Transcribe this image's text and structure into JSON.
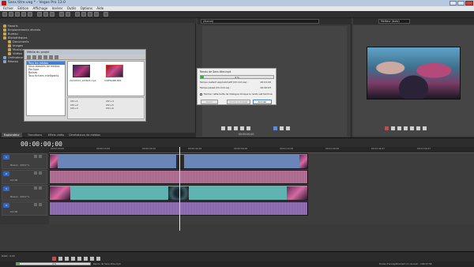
{
  "window": {
    "title": "Sans titre.veg * - Vegas Pro 13.0"
  },
  "menu": [
    "Fichier",
    "Edition",
    "Affichage",
    "Insérer",
    "Outils",
    "Options",
    "Aide"
  ],
  "explorer": {
    "tree": [
      "Favoris",
      "Emplacements récents",
      "Bureau",
      "Bibliothèques",
      "Documents",
      "Images",
      "Musique",
      "Vidéos",
      "Ordinateur",
      "Réseau"
    ]
  },
  "media_dialog": {
    "title": "Média du projet",
    "list": [
      "Tous les médias",
      "Sous-dossiers de médias",
      "Par type",
      "Balises",
      "Tous fichiers intelligents"
    ],
    "files": [
      "20140512_220823.mp4",
      "SUPFRABB.MP4"
    ],
    "props": [
      [
        "Ctrl+1",
        "Ctrl+4"
      ],
      [
        "Ctrl+2",
        "Ctrl+5"
      ],
      [
        "Ctrl+3",
        "Ctrl+6"
      ]
    ]
  },
  "explorer_tabs": [
    "Explorateur",
    "Transitions",
    "Effets vidéo",
    "Générateurs de médias"
  ],
  "trimmer": {
    "select_value": "(Aucun)"
  },
  "render_dialog": {
    "filename": "Rendu de Sans titre.mp4",
    "progress": 0.04,
    "progress_label": "4 %",
    "rows": [
      {
        "label": "Temps restant approximatif (hh:mm:ss) :",
        "value": "00:01:20"
      },
      {
        "label": "Temps passé (hh:mm:ss) :",
        "value": "00:00:03"
      }
    ],
    "checkbox_label": "Fermer cette boîte de dialogue lorsque le rendu est terminé",
    "buttons": [
      "Ouvrir",
      "Ouvrir le dossier",
      "Annuler"
    ]
  },
  "trimmer_timecode": "00:00:00;00",
  "preview": {
    "select_value": "Meilleur (Auto)",
    "info": [
      "Projet : 1920x1080x32, 29,970p",
      "Aperçu : 960x540x32, 29,970p",
      "Affichage : 400x225x32"
    ],
    "info_right": [
      "Image : 0",
      "Affichage : 400x225x32"
    ],
    "timecode": "00:00:00;00"
  },
  "timeline": {
    "timecode": "00:00:00;00",
    "ruler": [
      "00:00:00;00",
      "00:00:15;00",
      "00:00:29;29",
      "00:00:44;29",
      "00:00:59;28",
      "00:01:14;28",
      "00:01:29;28",
      "00:01:44;27",
      "00:01:59;27"
    ],
    "tracks": [
      {
        "num": "1",
        "level": "Niveau : 100,0 %"
      },
      {
        "num": "2",
        "level": "0,0 dB"
      },
      {
        "num": "3",
        "level": "Niveau : 100,0 %"
      },
      {
        "num": "4",
        "level": "0,0 dB"
      }
    ]
  },
  "status": {
    "rate": "Débit : 0,00",
    "render_pct": "4 %",
    "render_file": "Rendu de Sans titre.mp4",
    "record_time": "Durée d'enregistrement (2 canaux) : 166:32:56"
  }
}
